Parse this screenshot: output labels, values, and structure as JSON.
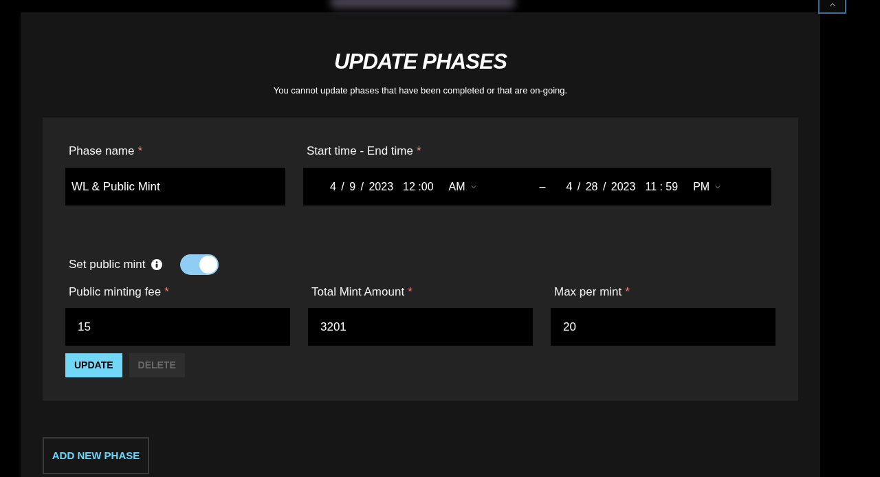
{
  "header": {
    "title": "UPDATE PHASES",
    "subtitle": "You cannot update phases that have been completed or that are on-going."
  },
  "phase": {
    "name_field": {
      "label": "Phase name",
      "required_mark": "*",
      "value": "WL & Public Mint"
    },
    "time_field": {
      "label": "Start time - End time",
      "required_mark": "*",
      "start": {
        "date": "4 / 9 / 2023",
        "time": "12 :00",
        "period": "AM"
      },
      "separator": "–",
      "end": {
        "date": "4 / 28 / 2023",
        "time": "11 : 59",
        "period": "PM"
      }
    },
    "public_mint": {
      "label": "Set public mint",
      "on": true
    },
    "mint_fields": [
      {
        "label": "Public minting fee",
        "required_mark": "*",
        "value": "15"
      },
      {
        "label": "Total Mint Amount",
        "required_mark": "*",
        "value": "3201"
      },
      {
        "label": "Max per mint",
        "required_mark": "*",
        "value": "20"
      }
    ],
    "buttons": [
      {
        "label": "UPDATE",
        "disabled": false
      },
      {
        "label": "DELETE",
        "disabled": true
      }
    ]
  },
  "add_phase_button": {
    "label": "ADD NEW PHASE"
  }
}
